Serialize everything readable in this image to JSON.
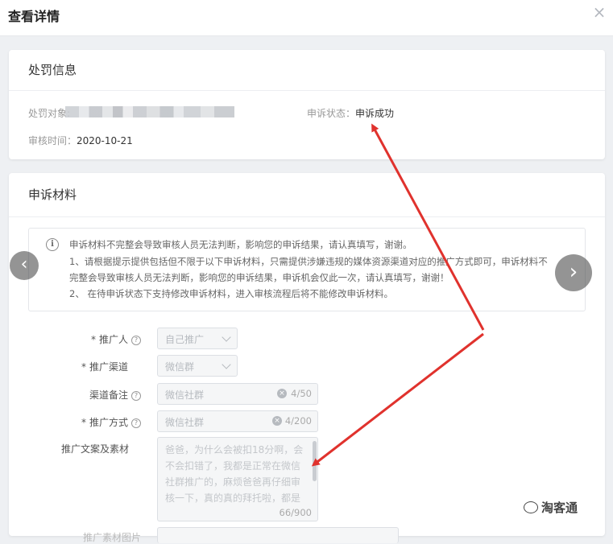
{
  "dialog": {
    "title": "查看详情",
    "close_glyph": "×"
  },
  "penalty_card": {
    "title": "处罚信息",
    "target_label": "处罚对象:",
    "appeal_status_label": "申诉状态：",
    "appeal_status_value": "申诉成功",
    "review_time_label": "审核时间：",
    "review_time_value": "2020-10-21"
  },
  "materials_card": {
    "title": "申诉材料",
    "notice": {
      "icon": "i",
      "line1": "申诉材料不完整会导致审核人员无法判断，影响您的申诉结果，请认真填写，谢谢。",
      "line2": "1、请根据提示提供包括但不限于以下申诉材料，只需提供涉嫌违规的媒体资源渠道对应的推广方式即可，申诉材料不",
      "line3": "完整会导致审核人员无法判断，影响您的申诉结果，申诉机会仅此一次，请认真填写，谢谢！",
      "line4": "2、 在待申诉状态下支持修改申诉材料，进入审核流程后将不能修改申诉材料。"
    },
    "form": {
      "promoter": {
        "required": "*",
        "label": "推广人",
        "help": "?",
        "value": "自己推广"
      },
      "channel": {
        "required": "*",
        "label": "推广渠道",
        "value": "微信群"
      },
      "channel_note": {
        "label": "渠道备注",
        "help": "?",
        "value": "微信社群",
        "count": "4/50"
      },
      "promo_method": {
        "required": "*",
        "label": "推广方式",
        "help": "?",
        "value": "微信社群",
        "count": "4/200"
      },
      "copy_material": {
        "label": "推广文案及素材",
        "lines": [
          "爸爸，为什么会被扣18分啊，会",
          "不会扣错了，我都是正常在微信",
          "社群推广的，麻烦爸爸再仔细审",
          "核一下，真的真的拜托啦，都是"
        ],
        "count": "66/900"
      },
      "next_label_partial": "推广素材图片"
    }
  },
  "carousel": {
    "prev": "‹",
    "next": "›"
  },
  "watermark": {
    "text": "淘客通"
  },
  "colors": {
    "arrow": "#e0322d",
    "background": "#eef0f3"
  }
}
